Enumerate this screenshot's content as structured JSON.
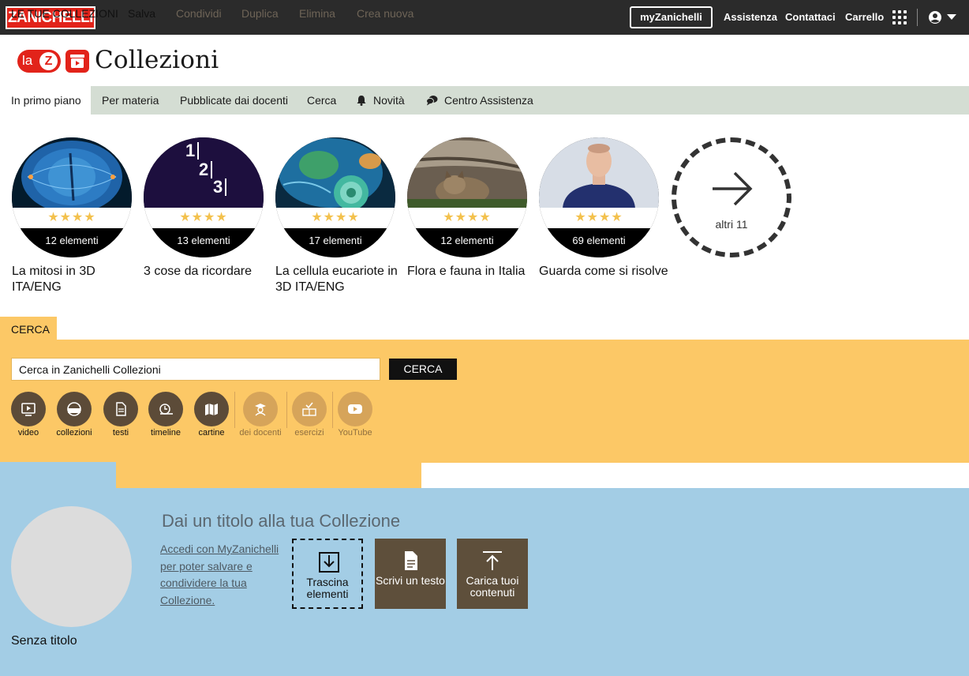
{
  "topbar": {
    "logo": "ZANICHELLI",
    "my_button": "myZanichelli",
    "links": [
      "Assistenza",
      "Contattaci",
      "Carrello"
    ]
  },
  "brand": {
    "la": "la",
    "z": "Z",
    "title": "Collezioni"
  },
  "nav": {
    "items": [
      "In primo piano",
      "Per materia",
      "Pubblicate dai docenti",
      "Cerca",
      "Novità",
      "Centro Assistenza"
    ]
  },
  "featured": [
    {
      "title": "La mitosi in 3D ITA/ENG",
      "count": "12 elementi",
      "stars": "★★★★"
    },
    {
      "title": "3 cose da ricordare",
      "count": "13 elementi",
      "stars": "★★★★",
      "numbers": [
        "1",
        "2",
        "3"
      ]
    },
    {
      "title": "La cellula eucariote in 3D ITA/ENG",
      "count": "17 elementi",
      "stars": "★★★★"
    },
    {
      "title": "Flora e fauna in Italia",
      "count": "12 elementi",
      "stars": "★★★★"
    },
    {
      "title": "Guarda come si risolve",
      "count": "69 elementi",
      "stars": "★★★★"
    }
  ],
  "more": {
    "label": "altri 11"
  },
  "search": {
    "tab": "CERCA",
    "input_value": "Cerca in Zanichelli Collezioni",
    "button": "CERCA",
    "filters": [
      {
        "label": "video",
        "icon": "video-icon"
      },
      {
        "label": "collezioni",
        "icon": "collection-icon"
      },
      {
        "label": "testi",
        "icon": "text-icon"
      },
      {
        "label": "timeline",
        "icon": "timeline-icon"
      },
      {
        "label": "cartine",
        "icon": "map-icon"
      },
      {
        "label": "dei docenti",
        "icon": "teacher-icon"
      },
      {
        "label": "esercizi",
        "icon": "exercise-icon"
      },
      {
        "label": "YouTube",
        "icon": "youtube-icon"
      }
    ]
  },
  "collections": {
    "tabs": [
      "LE TUE COLLEZIONI",
      "Salva",
      "Condividi",
      "Duplica",
      "Elimina",
      "Crea nuova"
    ],
    "title_placeholder": "Dai un titolo alla tua Collezione",
    "login_link": "Accedi con MyZanichelli per poter salvare e condividere la tua Collezione.",
    "untitled": "Senza titolo",
    "actions": [
      {
        "label": "Trascina elementi",
        "icon": "download-icon"
      },
      {
        "label": "Scrivi un testo",
        "icon": "document-icon"
      },
      {
        "label": "Carica tuoi contenuti",
        "icon": "upload-icon"
      }
    ]
  },
  "colors": {
    "brand_red": "#e2231a",
    "topbar": "#2b2b2b",
    "nav_bg": "#d4ddd3",
    "search_bg": "#fcc866",
    "collections_bg": "#a3cde5",
    "filter_dark": "#5c4b38",
    "star": "#f3c14d"
  }
}
